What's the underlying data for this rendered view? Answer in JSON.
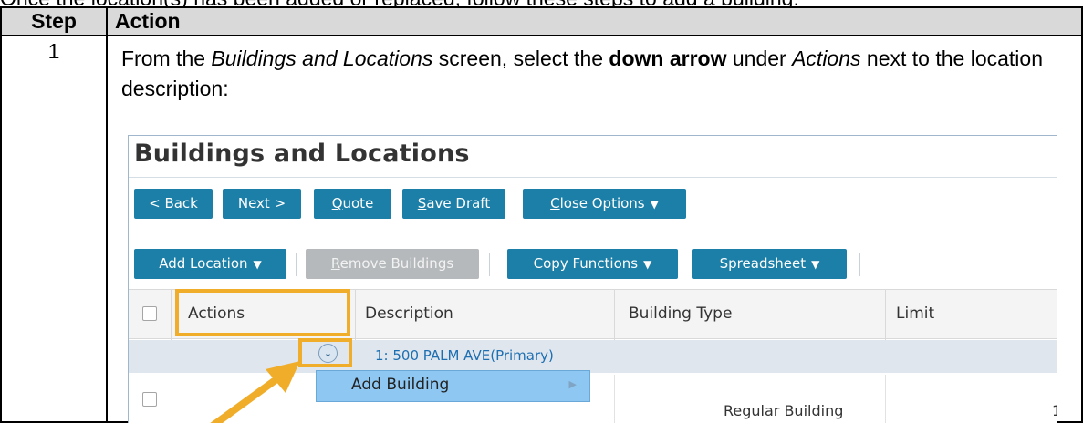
{
  "intro_fragment": "Once the location(s) has been added or replaced, follow these steps to add a building:",
  "table": {
    "headers": {
      "step": "Step",
      "action": "Action"
    },
    "rows": [
      {
        "step": "1",
        "instruction": {
          "t1": "From the ",
          "t2": "Buildings and Locations",
          "t3": " screen, select the ",
          "t4": "down arrow",
          "t5": " under ",
          "t6": "Actions",
          "t7": " next to the location description:"
        }
      }
    ]
  },
  "screenshot": {
    "title": "Buildings and Locations",
    "toolbar1": {
      "back": "< Back",
      "next": "Next >",
      "quote_u": "Q",
      "quote_rest": "uote",
      "save_u": "S",
      "save_rest": "ave Draft",
      "close_u": "C",
      "close_rest": "lose Options"
    },
    "toolbar2": {
      "add_location": "Add Location",
      "remove_u": "R",
      "remove_rest": "emove Buildings",
      "copy_functions": "Copy Functions",
      "spreadsheet": "Spreadsheet"
    },
    "columns": [
      "Actions",
      "Description",
      "Building Type",
      "Limit"
    ],
    "location_row": "1: 500 PALM AVE(Primary)",
    "menu_item": "Add Building",
    "building_type_value": "Regular Building",
    "limit_value_partial": "1",
    "icons": {
      "dropdown_caret": "▼",
      "submenu_caret": "▶",
      "expand_chevron": "⌄"
    },
    "colors": {
      "button": "#1b7fa8",
      "highlight": "#f0ad2a",
      "menu": "#8ec8f2",
      "link": "#1d6fb1"
    }
  }
}
